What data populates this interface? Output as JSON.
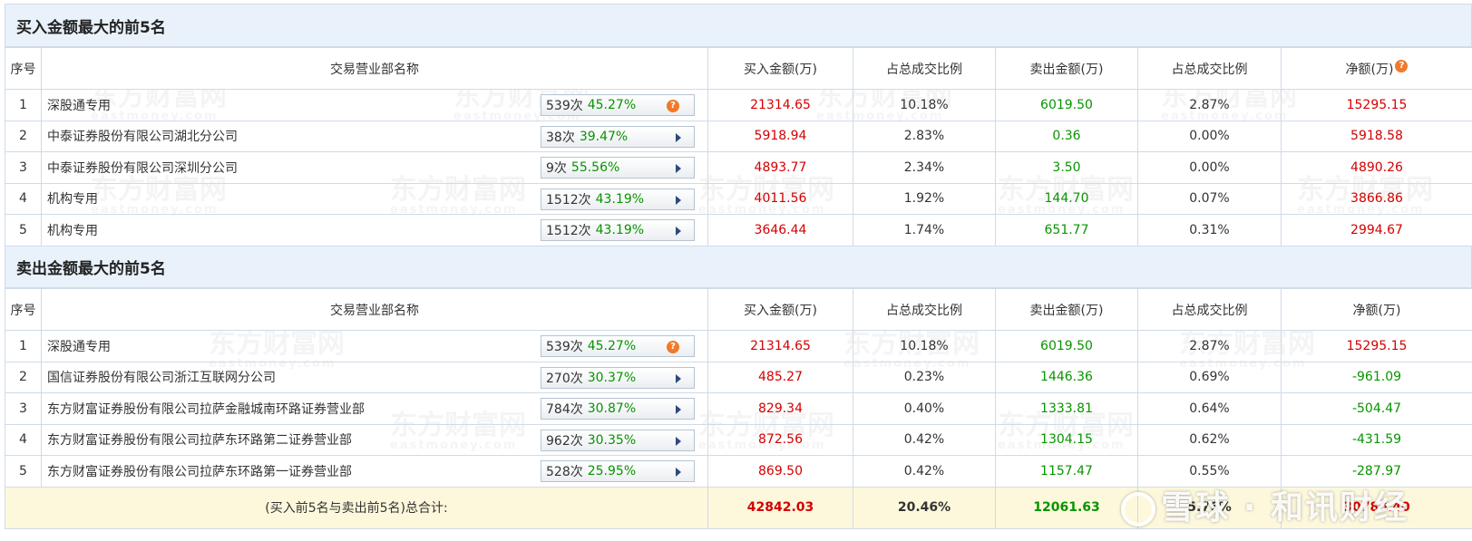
{
  "buy_section": {
    "title": "买入金额最大的前5名",
    "headers": [
      "序号",
      "交易营业部名称",
      "买入金额(万)",
      "占总成交比例",
      "卖出金额(万)",
      "占总成交比例",
      "净额(万)"
    ],
    "rows": [
      {
        "idx": "1",
        "name": "深股通专用",
        "count": "539次",
        "pct": "45.27%",
        "badge_icon": "question-icon",
        "buy": "21314.65",
        "buy_ratio": "10.18%",
        "sell": "6019.50",
        "sell_ratio": "2.87%",
        "net": "15295.15"
      },
      {
        "idx": "2",
        "name": "中泰证券股份有限公司湖北分公司",
        "count": "38次",
        "pct": "39.47%",
        "badge_icon": "play-arrow-icon",
        "buy": "5918.94",
        "buy_ratio": "2.83%",
        "sell": "0.36",
        "sell_ratio": "0.00%",
        "net": "5918.58"
      },
      {
        "idx": "3",
        "name": "中泰证券股份有限公司深圳分公司",
        "count": "9次",
        "pct": "55.56%",
        "badge_icon": "play-arrow-icon",
        "buy": "4893.77",
        "buy_ratio": "2.34%",
        "sell": "3.50",
        "sell_ratio": "0.00%",
        "net": "4890.26"
      },
      {
        "idx": "4",
        "name": "机构专用",
        "count": "1512次",
        "pct": "43.19%",
        "badge_icon": "play-arrow-icon",
        "buy": "4011.56",
        "buy_ratio": "1.92%",
        "sell": "144.70",
        "sell_ratio": "0.07%",
        "net": "3866.86"
      },
      {
        "idx": "5",
        "name": "机构专用",
        "count": "1512次",
        "pct": "43.19%",
        "badge_icon": "play-arrow-icon",
        "buy": "3646.44",
        "buy_ratio": "1.74%",
        "sell": "651.77",
        "sell_ratio": "0.31%",
        "net": "2994.67"
      }
    ]
  },
  "sell_section": {
    "title": "卖出金额最大的前5名",
    "headers": [
      "序号",
      "交易营业部名称",
      "买入金额(万)",
      "占总成交比例",
      "卖出金额(万)",
      "占总成交比例",
      "净额(万)"
    ],
    "rows": [
      {
        "idx": "1",
        "name": "深股通专用",
        "count": "539次",
        "pct": "45.27%",
        "badge_icon": "question-icon",
        "buy": "21314.65",
        "buy_ratio": "10.18%",
        "sell": "6019.50",
        "sell_ratio": "2.87%",
        "net": "15295.15"
      },
      {
        "idx": "2",
        "name": "国信证券股份有限公司浙江互联网分公司",
        "count": "270次",
        "pct": "30.37%",
        "badge_icon": "play-arrow-icon",
        "buy": "485.27",
        "buy_ratio": "0.23%",
        "sell": "1446.36",
        "sell_ratio": "0.69%",
        "net": "-961.09"
      },
      {
        "idx": "3",
        "name": "东方财富证券股份有限公司拉萨金融城南环路证券营业部",
        "count": "784次",
        "pct": "30.87%",
        "badge_icon": "play-arrow-icon",
        "buy": "829.34",
        "buy_ratio": "0.40%",
        "sell": "1333.81",
        "sell_ratio": "0.64%",
        "net": "-504.47"
      },
      {
        "idx": "4",
        "name": "东方财富证券股份有限公司拉萨东环路第二证券营业部",
        "count": "962次",
        "pct": "30.35%",
        "badge_icon": "play-arrow-icon",
        "buy": "872.56",
        "buy_ratio": "0.42%",
        "sell": "1304.15",
        "sell_ratio": "0.62%",
        "net": "-431.59"
      },
      {
        "idx": "5",
        "name": "东方财富证券股份有限公司拉萨东环路第一证券营业部",
        "count": "528次",
        "pct": "25.95%",
        "badge_icon": "play-arrow-icon",
        "buy": "869.50",
        "buy_ratio": "0.42%",
        "sell": "1157.47",
        "sell_ratio": "0.55%",
        "net": "-287.97"
      }
    ],
    "total": {
      "label": "(买入前5名与卖出前5名)总合计:",
      "buy": "42842.03",
      "buy_ratio": "20.46%",
      "sell": "12061.63",
      "sell_ratio": "5.76%",
      "net": "30780.40"
    }
  },
  "watermark": {
    "brand": "东方财富网",
    "domain": "eastmoney.com"
  },
  "footer_logo": "雪球 · 和讯财经",
  "colors": {
    "up": "#d40000",
    "down": "#089400",
    "header_bg": "#e9f2fb",
    "total_bg": "#fdf8dc"
  }
}
